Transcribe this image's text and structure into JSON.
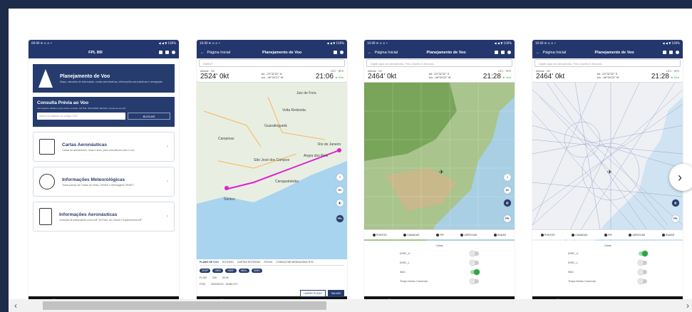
{
  "colors": {
    "background": "#1c2c4a",
    "brand": "#23366d",
    "accent": "#2aa745",
    "route": "#e01fcf"
  },
  "screen1": {
    "status_left": "09:00 ✉ ⊙ ⊙ •",
    "status_right": "◀ ◀ ▼ 100%",
    "app_logo": "FPL BR",
    "hero_title": "Planejamento de Voo",
    "hero_sub": "Mapa, camadas de informação, cartas aeronáuticas, informações aeronáuticas e navegação.",
    "consulta_title": "Consulta Prévia ao Voo",
    "consulta_sub": "Informações válidas a partir desta consulta. NOTAM, INFOTEMP, METAR e Suplementos AIP.",
    "consulta_placeholder": "Insira a localidade ou código ICAO",
    "consulta_button": "BUSCAR",
    "cards": [
      {
        "label": "Cartas Aeronáuticas",
        "desc": "Cartas de aeródromos, rotas e área, para consulta em todo o voo",
        "icon": "map-icon"
      },
      {
        "label": "Informações Meteorológicas",
        "desc": "Todos países de Cartas de Vento, SIGWX e Mensagens OPMET",
        "icon": "weather-icon"
      },
      {
        "label": "Informações Aeronáuticas",
        "desc": "Consulta de publicações como AIP, NOTAM, AIC Brasil e Suplementos AIP",
        "icon": "document-icon"
      }
    ]
  },
  "screen2": {
    "status_left": "10:00 ✉ ⊙ ⊙ •",
    "status_right": "◀ ◀ ▼ 100%",
    "back_label": "Página Inicial",
    "title": "Planejamento de Voo",
    "search": "DARAT",
    "alt_label": "Altitude",
    "gs_label": "GS",
    "alt": "2524'",
    "gs": "0kt",
    "lat": "lat. -23°32'32\" N",
    "lon": "lon. -46°34'21\" W",
    "utc_label": "UTC",
    "gps_label": "GPS",
    "time": "21:06",
    "gps": "● 10m",
    "places": [
      "Juiz de Fora",
      "Campinas",
      "Guaratinguetá",
      "São José dos Campos",
      "Rio de Janeiro",
      "Santos",
      "Caraguatatuba",
      "Volta Redonda",
      "Angra dos Reis"
    ],
    "plano_tabs": [
      "PLANO DE VOO",
      "ROTEIRO",
      "CARTAS ROTEIRAS",
      "ROTAS",
      "CONSULTAR MENSAGENS RTS"
    ],
    "chips": [
      "SBSP",
      "SBRJ",
      "SBSP",
      "SBGL",
      "SBRJ"
    ],
    "field1": "FL100",
    "field2": "200",
    "field3": "00:45",
    "field4": "F243",
    "field5": "2022/01/13 · 20:58 UTC",
    "btn_clear": "LIMPAR PLANO",
    "btn_save": "SALVAR"
  },
  "screen3": {
    "status_left": "10:00 ✉ ⊙ ⊙ •",
    "status_right": "◀ ◀ ▼ 100%",
    "back_label": "Página Inicial",
    "title": "Planejamento de Voo",
    "search": "Digite aqui um Aeródromo, Fixo, Auxílio e Aerovia...",
    "alt_label": "Altitude",
    "gs_label": "GS",
    "alt": "2464'",
    "gs": "0kt",
    "lat": "lat. -23°32'32\" S",
    "lon": "lon. -46°34'22\" W",
    "utc_label": "UTC",
    "gps_label": "GPS",
    "time": "21:28",
    "gps": "● 14m"
  },
  "screen4": {
    "status_left": "10:00 ✉ ⊙ ⊙ •",
    "status_right": "◀ ◀ ▼ 100%",
    "back_label": "Página Inicial",
    "title": "Planejamento de Voo",
    "search": "Digite aqui um Aeródromo, Fixo, Auxílio e Aerovia...",
    "alt_label": "Altitude",
    "gs_label": "GS",
    "alt": "2464'",
    "gs": "0kt",
    "lat": "lat. -23°32'32\" S",
    "lon": "lon. -46°34'22\" W",
    "utc_label": "UTC",
    "gps_label": "GPS",
    "time": "21:28",
    "gps": "● 14m"
  },
  "bottom_tabs": [
    "PONTOS",
    "CAMADAS",
    "FIR",
    "AEROVIAS",
    "RADAR"
  ],
  "layers_title": "Cartas",
  "layers": [
    "ENRC_H",
    "ENRC_L",
    "WAC",
    "Tempo Dentro Comercial"
  ],
  "fab_labels": [
    "+",
    "NV",
    "◧",
    "FPL"
  ],
  "nav": [
    "|||",
    "○",
    "<"
  ]
}
